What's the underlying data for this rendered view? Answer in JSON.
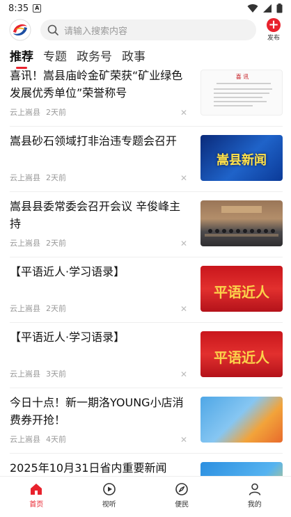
{
  "status": {
    "time": "8:35",
    "notification_letter": "A"
  },
  "header": {
    "search_placeholder": "请输入搜索内容",
    "publish_label": "发布"
  },
  "tabs": [
    {
      "label": "推荐",
      "active": true
    },
    {
      "label": "专题",
      "active": false
    },
    {
      "label": "政务号",
      "active": false
    },
    {
      "label": "政事",
      "active": false
    }
  ],
  "feed": [
    {
      "title": "喜讯！嵩县庙岭金矿荣获“矿业绿色发展优秀单位”荣誉称号",
      "source": "云上嵩县",
      "time": "2天前",
      "thumb": "doc",
      "thumb_caption": "喜 讯"
    },
    {
      "title": "嵩县砂石领域打非治违专题会召开",
      "source": "云上嵩县",
      "time": "2天前",
      "thumb": "news",
      "thumb_caption": "嵩县新闻"
    },
    {
      "title": "嵩县县委常委会召开会议 辛俊峰主持",
      "source": "云上嵩县",
      "time": "2天前",
      "thumb": "meeting",
      "thumb_caption": ""
    },
    {
      "title": "【平语近人·学习语录】",
      "source": "云上嵩县",
      "time": "2天前",
      "thumb": "red",
      "thumb_caption": "平语近人"
    },
    {
      "title": "【平语近人·学习语录】",
      "source": "云上嵩县",
      "time": "3天前",
      "thumb": "red",
      "thumb_caption": "平语近人"
    },
    {
      "title": "今日十点！新一期洛YOUNG小店消费券开抢！",
      "source": "云上嵩县",
      "time": "4天前",
      "thumb": "shop",
      "thumb_caption": ""
    },
    {
      "title": "2025年10月31日省内重要新闻",
      "source": "",
      "time": "",
      "thumb": "blue",
      "thumb_caption": ""
    }
  ],
  "bottom_nav": [
    {
      "label": "首页",
      "icon": "home-icon",
      "active": true
    },
    {
      "label": "视听",
      "icon": "play-icon",
      "active": false
    },
    {
      "label": "便民",
      "icon": "compass-icon",
      "active": false
    },
    {
      "label": "我的",
      "icon": "user-icon",
      "active": false
    }
  ],
  "colors": {
    "accent": "#e8222d",
    "text": "#111111",
    "meta": "#999999"
  }
}
